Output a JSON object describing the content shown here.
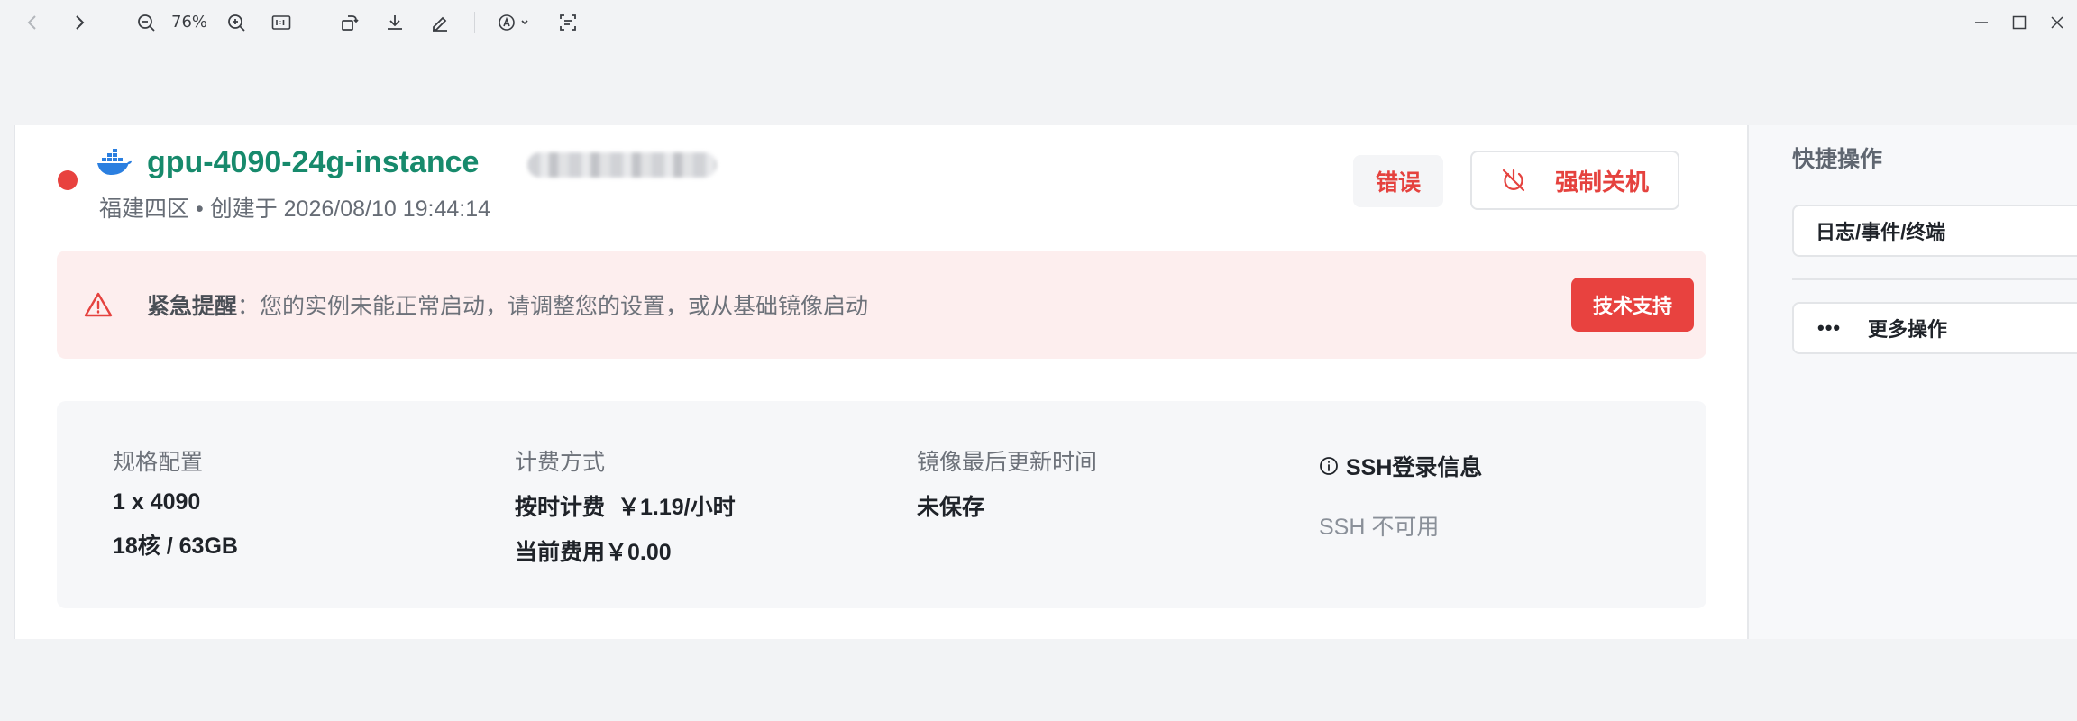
{
  "toolbar": {
    "zoom": "76%",
    "icons": [
      "back-icon",
      "forward-icon",
      "zoom-out-icon",
      "zoom-in-icon",
      "actual-size-icon",
      "rotate-icon",
      "download-icon",
      "annotate-icon",
      "text-recognize-icon",
      "scan-icon",
      "minimize-icon",
      "maximize-icon",
      "close-icon"
    ]
  },
  "instance": {
    "name": "gpu-4090-24g-instance",
    "region": "福建四区",
    "separator": "•",
    "created_prefix": "创建于",
    "created_at": "2026/08/10 19:44:14",
    "status_label": "错误",
    "force_shutdown_label": "强制关机",
    "status_color": "#e8423f",
    "name_color": "#178a6c"
  },
  "alert": {
    "title": "紧急提醒",
    "colon": "：",
    "message": "您的实例未能正常启动，请调整您的设置，或从基础镜像启动",
    "support_label": "技术支持"
  },
  "info": {
    "spec_label": "规格配置",
    "spec_gpu": "1 x 4090",
    "spec_cpu_mem": "18核 / 63GB",
    "billing_label": "计费方式",
    "billing_hourly_label": "按时计费",
    "billing_hourly_value": "￥1.19/小时",
    "billing_current_label": "当前费用",
    "billing_current_value": "￥0.00",
    "image_label": "镜像最后更新时间",
    "image_value": "未保存",
    "ssh_label": "SSH登录信息",
    "ssh_value": "SSH 不可用"
  },
  "sidebar": {
    "title": "快捷操作",
    "log_item": "日志/事件/终端",
    "more_item": "更多操作",
    "more_dots": "•••"
  }
}
